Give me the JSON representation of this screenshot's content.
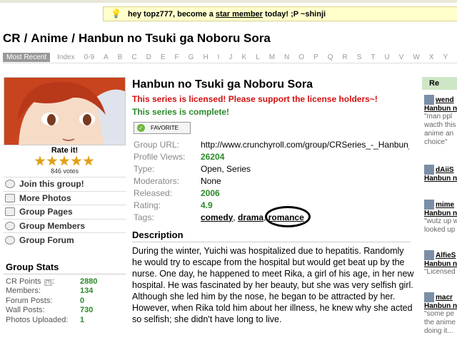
{
  "notice": {
    "prefix": "hey topz777, become a ",
    "link": "star member",
    "suffix": " today! ;P ~shinji"
  },
  "breadcrumb": [
    "CR",
    "Anime",
    "Hanbun no Tsuki ga Noboru Sora"
  ],
  "alpha_nav": [
    "Most Recent",
    "Index",
    "0-9",
    "A",
    "B",
    "C",
    "D",
    "E",
    "F",
    "G",
    "H",
    "I",
    "J",
    "K",
    "L",
    "M",
    "N",
    "O",
    "P",
    "Q",
    "R",
    "S",
    "T",
    "U",
    "V",
    "W",
    "X",
    "Y"
  ],
  "rating": {
    "title": "Rate it!",
    "votes": "846 votes",
    "stars": 5
  },
  "side_links": [
    "Join this group!",
    "More Photos",
    "Group Pages",
    "Group Members",
    "Group Forum"
  ],
  "stats": {
    "title": "Group Stats",
    "help": "[?]",
    "rows": [
      {
        "label": "CR Points",
        "value": "2880"
      },
      {
        "label": "Members:",
        "value": "134"
      },
      {
        "label": "Forum Posts:",
        "value": "0"
      },
      {
        "label": "Wall Posts:",
        "value": "730"
      },
      {
        "label": "Photos Uploaded:",
        "value": "1"
      }
    ]
  },
  "series": {
    "title": "Hanbun no Tsuki ga Noboru Sora",
    "licensed": "This series is licensed! Please support the license holders~!",
    "complete": "This series is complete!",
    "favorite": "FAVORITE"
  },
  "info": {
    "url_label": "Group URL:",
    "url": "http://www.crunchyroll.com/group/CRSeries_-_Hanbun_no_Tsuki_ga_Noboru_Sora",
    "views_label": "Profile Views:",
    "views": "26204",
    "type_label": "Type:",
    "type": "Open, Series",
    "mods_label": "Moderators:",
    "mods": "None",
    "released_label": "Released:",
    "released": "2006",
    "rating_label": "Rating:",
    "rating": "4.9",
    "tags_label": "Tags:",
    "tags": [
      "comedy",
      "drama",
      "romance"
    ],
    "tag_sep": ", "
  },
  "description": {
    "title": "Description",
    "text": "During the winter, Yuichi was hospitalized due to hepatitis. Randomly he would try to escape from the hospital but would get beat up by the nurse. One day, he happened to meet Rika, a girl of his age, in her new hospital. He was fascinated by her beauty, but she was very selfish girl. Although she led him by the nose, he began to be attracted by her. However, when Rika told him about her illness, he knew why she acted so selfish; she didn't have long to live."
  },
  "right_panel": {
    "head": "Re",
    "comments": [
      {
        "user": "wend",
        "link": "Hanbun n",
        "text": [
          "\"man ppl",
          "wacth this",
          "anime an",
          "choice\""
        ]
      },
      {
        "user": "dAiiS",
        "link": "Hanbun n",
        "text": []
      },
      {
        "user": "mime",
        "link": "Hanbun n",
        "text": [
          "\"wutz up w",
          "looked up"
        ]
      },
      {
        "user": "AlfieS",
        "link": "Hanbun n",
        "text": [
          "\"Licensed"
        ]
      },
      {
        "user": "macr",
        "link": "Hanbun n",
        "text": [
          "\"some pe",
          "the anime",
          "doing it..."
        ]
      }
    ]
  },
  "colors": {
    "green": "#2a8a2a",
    "red": "#d01010",
    "notice_bg": "#ffffcc",
    "right_head_bg": "#cfe6c6"
  }
}
